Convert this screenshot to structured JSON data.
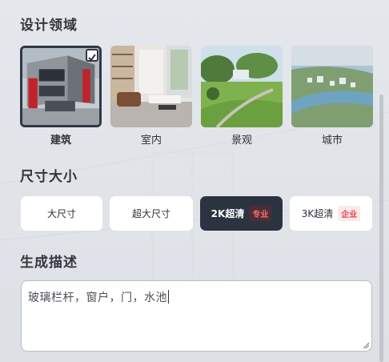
{
  "design_domain": {
    "title": "设计领域",
    "items": [
      {
        "label": "建筑",
        "selected": true
      },
      {
        "label": "室内",
        "selected": false
      },
      {
        "label": "景观",
        "selected": false
      },
      {
        "label": "城市",
        "selected": false
      }
    ]
  },
  "size": {
    "title": "尺寸大小",
    "options": [
      {
        "label": "大尺寸",
        "badge": "",
        "active": false
      },
      {
        "label": "超大尺寸",
        "badge": "",
        "active": false
      },
      {
        "label": "2K超清",
        "badge": "专业",
        "active": true
      },
      {
        "label": "3K超清",
        "badge": "企业",
        "active": false
      }
    ]
  },
  "description": {
    "title": "生成描述",
    "value": "玻璃栏杆，窗户，门，水池"
  },
  "colors": {
    "accent_dark": "#2b3340",
    "badge_red": "#e7434f"
  }
}
